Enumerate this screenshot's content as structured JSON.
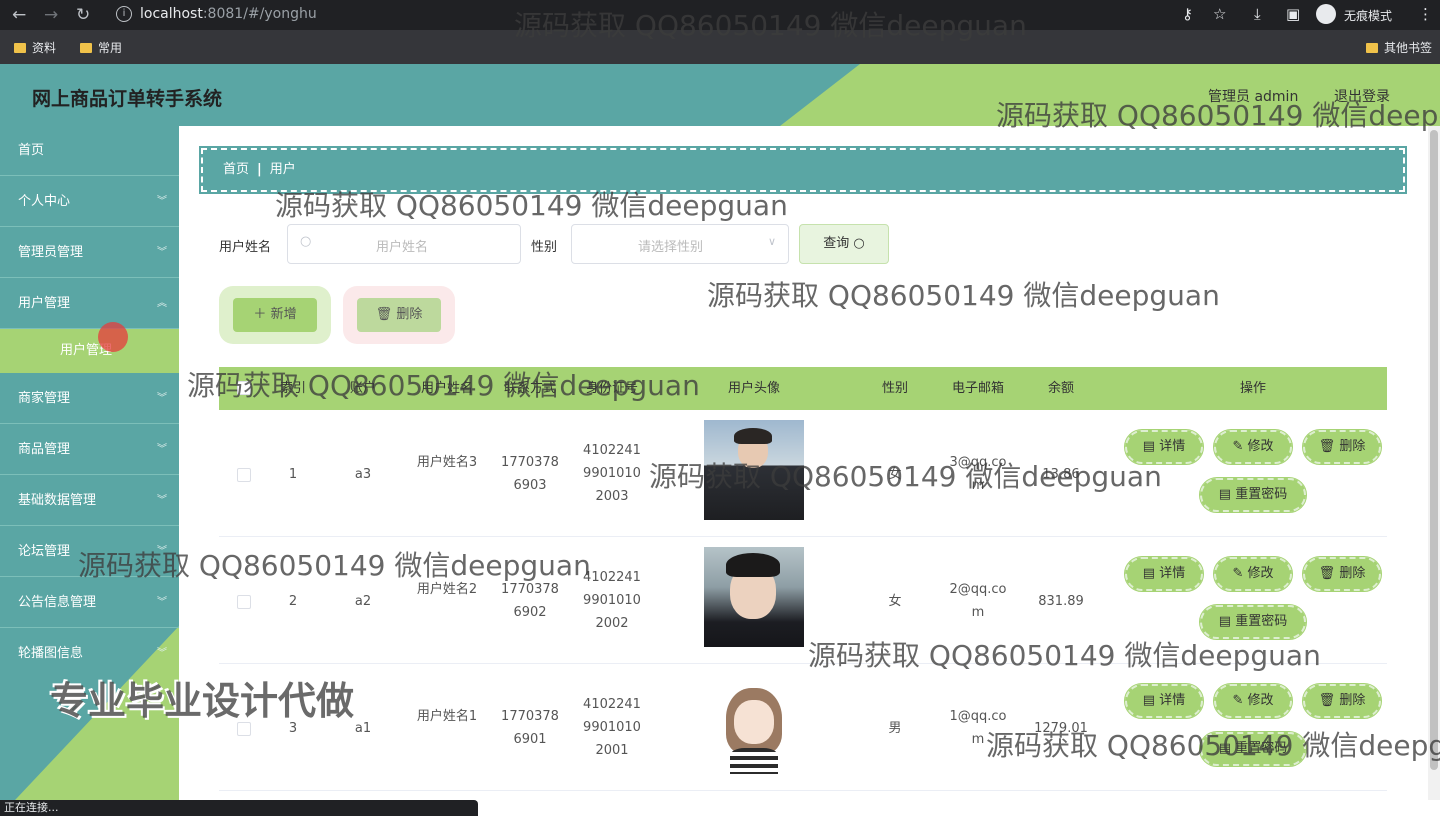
{
  "browser": {
    "url_host": "localhost",
    "url_path": ":8081/#/yonghu",
    "incognito_label": "无痕模式",
    "bookmarks": [
      "资料",
      "常用"
    ],
    "bookmarks_right": "其他书签",
    "status_text": "正在连接..."
  },
  "header": {
    "title": "网上商品订单转手系统",
    "user_label": "管理员 admin",
    "logout_label": "退出登录"
  },
  "sidebar": {
    "items": [
      {
        "label": "首页",
        "has_arrow": false
      },
      {
        "label": "个人中心",
        "has_arrow": true
      },
      {
        "label": "管理员管理",
        "has_arrow": true
      },
      {
        "label": "用户管理",
        "has_arrow": true
      },
      {
        "label": "商家管理",
        "has_arrow": true
      },
      {
        "label": "商品管理",
        "has_arrow": true
      },
      {
        "label": "基础数据管理",
        "has_arrow": true
      },
      {
        "label": "论坛管理",
        "has_arrow": true
      },
      {
        "label": "公告信息管理",
        "has_arrow": true
      },
      {
        "label": "轮播图信息",
        "has_arrow": true
      }
    ],
    "active_sub": "用户管理"
  },
  "breadcrumb": {
    "home": "首页",
    "current": "用户"
  },
  "search": {
    "name_label": "用户姓名",
    "name_placeholder": "用户姓名",
    "gender_label": "性别",
    "gender_placeholder": "请选择性别",
    "search_button": "查询"
  },
  "actions": {
    "add": "新增",
    "delete": "删除"
  },
  "table": {
    "headers": [
      "索引",
      "账户",
      "用户姓名",
      "联系方式",
      "身份证号",
      "用户头像",
      "性别",
      "电子邮箱",
      "余额",
      "操作"
    ],
    "rows": [
      {
        "index": "1",
        "account": "a3",
        "name": "用户姓名3",
        "phone": "17703786903",
        "id_card": "410224199010102003",
        "gender": "女",
        "email": "3@qq.com",
        "balance": "13.86"
      },
      {
        "index": "2",
        "account": "a2",
        "name": "用户姓名2",
        "phone": "17703786902",
        "id_card": "410224199010102002",
        "gender": "女",
        "email": "2@qq.com",
        "balance": "831.89"
      },
      {
        "index": "3",
        "account": "a1",
        "name": "用户姓名1",
        "phone": "17703786901",
        "id_card": "410224199010102001",
        "gender": "男",
        "email": "1@qq.com",
        "balance": "1279.01"
      }
    ],
    "row_buttons": {
      "detail": "详情",
      "edit": "修改",
      "delete": "删除",
      "reset": "重置密码"
    }
  },
  "watermarks": {
    "text": "源码获取 QQ86050149 微信deepguan",
    "big": "专业毕业设计代做"
  },
  "colors": {
    "teal": "#5aa6a4",
    "green": "#a6d374"
  }
}
